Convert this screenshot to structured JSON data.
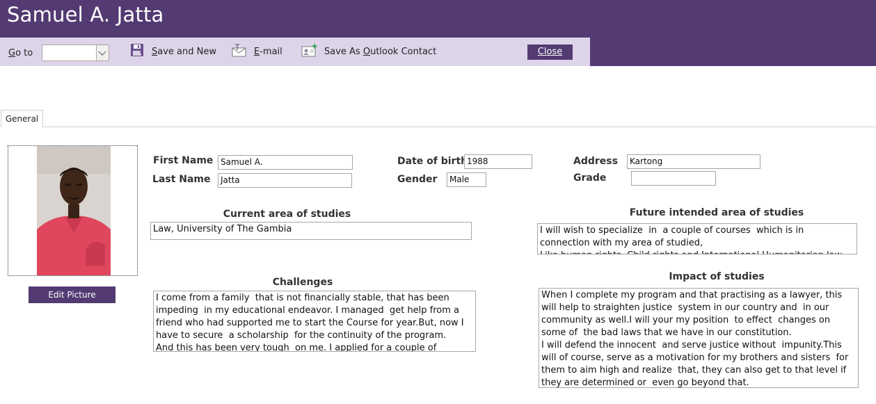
{
  "window": {
    "title": "Samuel A. Jatta"
  },
  "toolbar": {
    "goto_label": "Go to",
    "goto_value": "",
    "save_new_label": "Save and New",
    "email_label": "E-mail",
    "outlook_label": "Save As Outlook Contact",
    "close_label": "Close"
  },
  "tabs": [
    {
      "label": "General"
    }
  ],
  "photo": {
    "edit_label": "Edit Picture"
  },
  "form": {
    "first_name_label": "First Name",
    "first_name": "Samuel A.",
    "last_name_label": "Last Name",
    "last_name": "Jatta",
    "dob_label": "Date of birth",
    "dob": "1988",
    "gender_label": "Gender",
    "gender": "Male",
    "address_label": "Address",
    "address": "Kartong",
    "grade_label": "Grade",
    "grade": ""
  },
  "sections": {
    "current_title": "Current area of studies",
    "current_text": "Law, University of The Gambia",
    "future_title": "Future intended area of studies",
    "future_text": "I will wish to specialize  in  a couple of courses  which is in connection with my area of studied,\nLike human rights, Child rights and International Humanitarian law",
    "challenges_title": "Challenges",
    "challenges_text": "I come from a family  that is not financially stable, that has been impeding  in my educational endeavor. I managed  get help from a friend who had supported me to start the Course for year.But, now I have to secure  a scholarship  for the continuity of the program.\nAnd this has been very tough  on me. I applied for a couple of scholarships",
    "impact_title": "Impact of studies",
    "impact_text": "When I complete my program and that practising as a lawyer, this will help to straighten justice  system in our country and  in our community as well.I will your my position  to effect  changes on some of  the bad laws that we have in our constitution.\nI will defend the innocent  and serve justice without  impunity.This will of course, serve as a motivation for my brothers and sisters  for them to aim high and realize  that, they can also get to that level if they are determined or  even go beyond that."
  },
  "colors": {
    "accent": "#533a72",
    "toolbar_bg": "#ded4e9"
  }
}
